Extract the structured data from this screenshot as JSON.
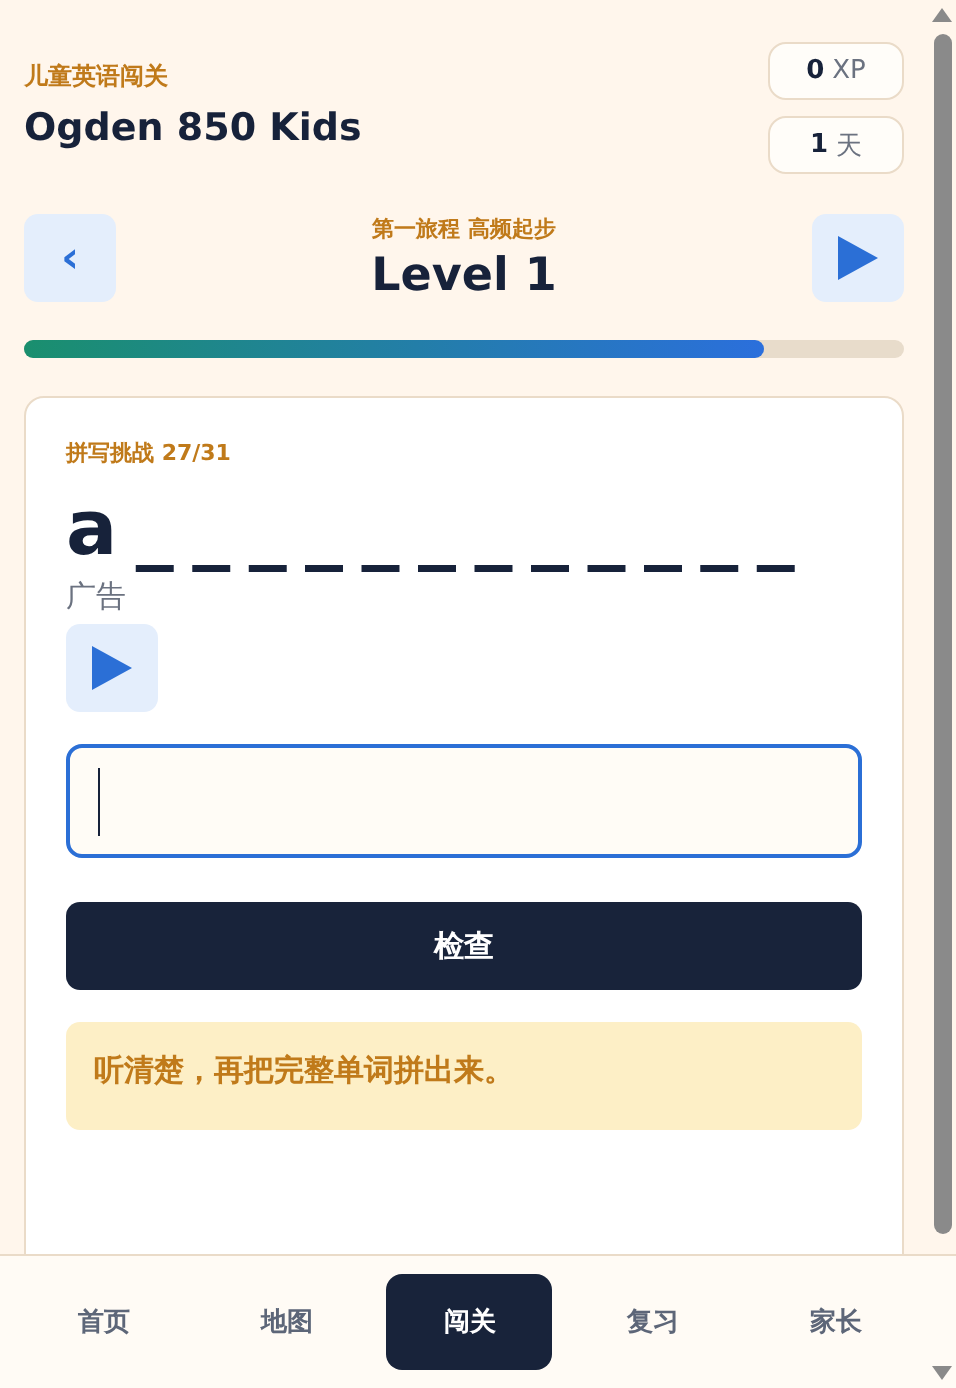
{
  "header": {
    "subtitle": "儿童英语闯关",
    "title": "Ogden 850 Kids",
    "stats": [
      {
        "value": "0",
        "unit": "XP"
      },
      {
        "value": "1",
        "unit": "天"
      }
    ]
  },
  "level_nav": {
    "journey": "第一旅程 高频起步",
    "title": "Level 1",
    "prev_icon": "‹",
    "progress": {
      "level": 0.84
    }
  },
  "card": {
    "label": "拼写挑战 27/31",
    "word_hint": "a _ _ _ _ _ _ _ _ _ _ _ _",
    "audio_label": "广告",
    "input": {
      "focused": true
    },
    "check_button": "检查",
    "hint": "听清楚，再把完整单词拼出来。"
  },
  "tabs": [
    {
      "label": "首页",
      "selected": false
    },
    {
      "label": "地图",
      "selected": false
    },
    {
      "label": "闯关",
      "selected": true
    },
    {
      "label": "复习",
      "selected": false
    },
    {
      "label": "家长",
      "selected": false
    }
  ]
}
